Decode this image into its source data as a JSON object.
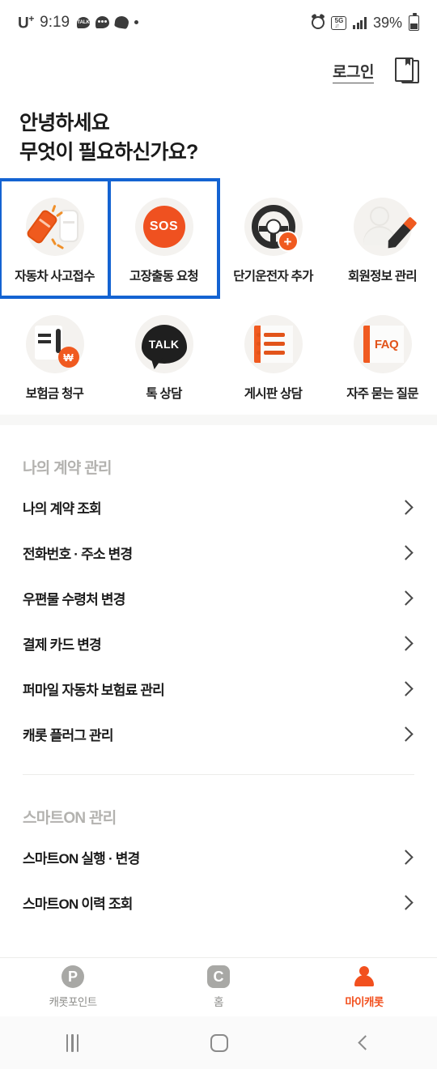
{
  "status_bar": {
    "carrier": "U",
    "carrier_sup": "+",
    "time": "9:19",
    "battery_percent": "39%",
    "icons": [
      "chat-bubble-icon",
      "message-bubble-icon",
      "swirl-icon",
      "dot-icon",
      "alarm-icon",
      "5g-icon",
      "signal-bars-icon",
      "battery-icon"
    ]
  },
  "header": {
    "login_label": "로그인",
    "bookmark_icon": "bookmark-document-icon"
  },
  "greeting": {
    "line1": "안녕하세요",
    "line2": "무엇이 필요하신가요?"
  },
  "quick_menu": [
    {
      "label": "자동차 사고접수",
      "icon": "car-crash-icon",
      "highlighted": true
    },
    {
      "label": "고장출동 요청",
      "icon": "sos-icon",
      "highlighted": true,
      "badge_text": "SOS"
    },
    {
      "label": "단기운전자 추가",
      "icon": "steering-wheel-plus-icon",
      "highlighted": false,
      "badge_text": "+"
    },
    {
      "label": "회원정보 관리",
      "icon": "person-edit-icon",
      "highlighted": false
    },
    {
      "label": "보험금 청구",
      "icon": "claim-document-won-icon",
      "highlighted": false,
      "badge_text": "₩"
    },
    {
      "label": "톡 상담",
      "icon": "talk-bubble-icon",
      "badge_text": "TALK",
      "highlighted": false
    },
    {
      "label": "게시판 상담",
      "icon": "board-list-icon",
      "highlighted": false
    },
    {
      "label": "자주 묻는 질문",
      "icon": "faq-book-icon",
      "badge_text": "FAQ",
      "highlighted": false
    }
  ],
  "sections": [
    {
      "title": "나의 계약 관리",
      "items": [
        "나의 계약 조회",
        "전화번호 · 주소 변경",
        "우편물 수령처 변경",
        "결제 카드 변경",
        "퍼마일 자동차 보험료 관리",
        "캐롯 플러그 관리"
      ]
    },
    {
      "title": "스마트ON 관리",
      "items": [
        "스마트ON 실행 · 변경",
        "스마트ON 이력 조회"
      ]
    }
  ],
  "tab_bar": [
    {
      "label": "캐롯포인트",
      "icon": "point-p-icon",
      "glyph": "P",
      "active": false
    },
    {
      "label": "홈",
      "icon": "home-c-icon",
      "glyph": "C",
      "active": false
    },
    {
      "label": "마이캐롯",
      "icon": "my-person-icon",
      "active": true
    }
  ],
  "android_nav": {
    "recents": "recents-icon",
    "home": "home-icon",
    "back": "back-icon"
  },
  "colors": {
    "accent_orange": "#F2501E",
    "highlight_blue": "#1463D2",
    "icon_bg": "#F4F2EF",
    "section_title_gray": "#B3B2AF"
  }
}
